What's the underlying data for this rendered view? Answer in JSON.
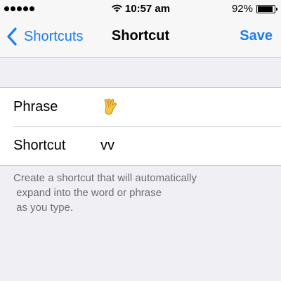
{
  "status_bar": {
    "signal_dots": 5,
    "time": "10:57 am",
    "battery_percent_label": "92%",
    "battery_level": 0.92
  },
  "nav": {
    "back_label": "Shortcuts",
    "title": "Shortcut",
    "save_label": "Save"
  },
  "form": {
    "phrase_label": "Phrase",
    "phrase_value_icon": "vulcan-salute-emoji",
    "shortcut_label": "Shortcut",
    "shortcut_value": "vv"
  },
  "footer": {
    "note": "Create a shortcut that will automatically\n expand into the word or phrase\n as you type."
  },
  "colors": {
    "accent": "#1c7cf5",
    "background": "#efeff4",
    "separator": "#c8c7cc",
    "footer_text": "#6d6d72"
  }
}
